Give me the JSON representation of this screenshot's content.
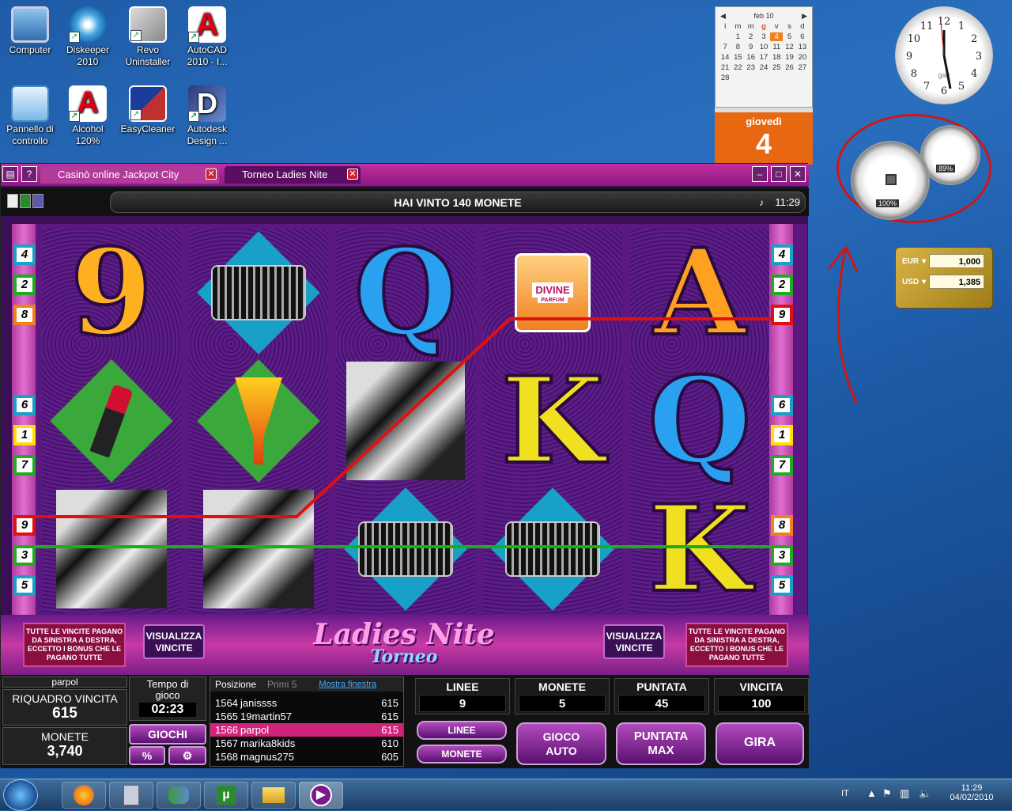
{
  "desktop_icons": [
    {
      "label": "Computer",
      "icon": "computer-icon"
    },
    {
      "label": "Diskeeper\n2010",
      "icon": "diskeeper-icon"
    },
    {
      "label": "Revo\nUninstaller",
      "icon": "revo-uninstaller-icon"
    },
    {
      "label": "AutoCAD\n2010 - I...",
      "icon": "autocad-icon"
    },
    {
      "label": "Pannello di\ncontrollo",
      "icon": "control-panel-icon"
    },
    {
      "label": "Alcohol\n120%",
      "icon": "alcohol-icon"
    },
    {
      "label": "EasyCleaner",
      "icon": "easycleaner-icon"
    },
    {
      "label": "Autodesk\nDesign ...",
      "icon": "autodesk-revit-icon"
    }
  ],
  "calendar": {
    "month": "feb 10",
    "weekdays": [
      "l",
      "m",
      "m",
      "g",
      "v",
      "s",
      "d"
    ],
    "days": [
      "",
      "1",
      "2",
      "3",
      "4",
      "5",
      "6",
      "7",
      "8",
      "9",
      "10",
      "11",
      "12",
      "13",
      "14",
      "15",
      "16",
      "17",
      "18",
      "19",
      "20",
      "21",
      "22",
      "23",
      "24",
      "25",
      "26",
      "27",
      "28"
    ],
    "today": "4",
    "weekday_label": "giovedì",
    "day_big": "4"
  },
  "clock": {
    "label": "gae",
    "hours": [
      "12",
      "1",
      "2",
      "3",
      "4",
      "5",
      "6",
      "7",
      "8",
      "9",
      "10",
      "11"
    ]
  },
  "meters": {
    "cpu": "100%",
    "ram": "89%"
  },
  "currency": {
    "rows": [
      {
        "code": "EUR",
        "value": "1,000"
      },
      {
        "code": "USD",
        "value": "1,385"
      }
    ]
  },
  "casino": {
    "tabs": [
      "Casinò online Jackpot City",
      "Torneo Ladies Nite"
    ],
    "message": "HAI VINTO 140 MONETE",
    "time": "11:29",
    "left_lines": [
      "4",
      "2",
      "8",
      "",
      "",
      "6",
      "1",
      "7",
      "",
      "9",
      "3",
      "5"
    ],
    "right_lines": [
      "4",
      "2",
      "9",
      "",
      "",
      "6",
      "1",
      "7",
      "",
      "8",
      "3",
      "5"
    ],
    "rules_text": "TUTTE LE VINCITE PAGANO DA SINISTRA A DESTRA, ECCETTO I BONUS CHE LE PAGANO TUTTE",
    "view_wins": "VISUALIZZA VINCITE",
    "logo_line1": "Ladies Nite",
    "logo_line2": "Torneo",
    "symbols": {
      "nine": "9",
      "q": "Q",
      "a": "A",
      "k": "K",
      "divine": "DIVINE",
      "parfum": "PARFUM"
    },
    "player": "parpol",
    "win_box_label": "RIQUADRO VINCITA",
    "win_box_value": "615",
    "coins_label": "MONETE",
    "coins_value": "3,740",
    "time_label": "Tempo di gioco",
    "time_value": "02:23",
    "games_label": "GIOCHI",
    "percent": "%",
    "leaderboard": {
      "tab1": "Posizione",
      "tab2": "Primi 5",
      "tab3": "Mostra finestra",
      "rows": [
        {
          "rank": "1564",
          "name": "janissss",
          "score": "615"
        },
        {
          "rank": "1565",
          "name": "19martin57",
          "score": "615"
        },
        {
          "rank": "1566",
          "name": "parpol",
          "score": "615"
        },
        {
          "rank": "1567",
          "name": "marika8kids",
          "score": "610"
        },
        {
          "rank": "1568",
          "name": "magnus275",
          "score": "605"
        }
      ]
    },
    "stats": [
      {
        "label": "LINEE",
        "value": "9"
      },
      {
        "label": "MONETE",
        "value": "5"
      },
      {
        "label": "PUNTATA",
        "value": "45"
      },
      {
        "label": "VINCITA",
        "value": "100"
      }
    ],
    "buttons": {
      "lines": "LINEE",
      "coins": "MONETE",
      "auto": "GIOCO AUTO",
      "max": "PUNTATA MAX",
      "spin": "GIRA"
    }
  },
  "taskbar": {
    "lang": "IT",
    "time": "11:29",
    "date": "04/02/2010"
  }
}
